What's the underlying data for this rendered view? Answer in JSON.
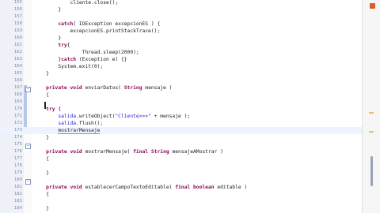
{
  "editor": {
    "lines": [
      {
        "num": "155",
        "code": "            cliente.close();"
      },
      {
        "num": "156",
        "code": "        }"
      },
      {
        "num": "157",
        "code": ""
      },
      {
        "num": "158",
        "code": "        catch( IOException excepcionES ) {"
      },
      {
        "num": "159",
        "code": "            excepcionES.printStackTrace();"
      },
      {
        "num": "160",
        "code": "        }"
      },
      {
        "num": "161",
        "code": "        try{"
      },
      {
        "num": "162",
        "code": "                Thread.sleep(2000);"
      },
      {
        "num": "163",
        "code": "        }catch (Exception e) {}"
      },
      {
        "num": "164",
        "code": "        System.exit(0);"
      },
      {
        "num": "165",
        "code": "    }"
      },
      {
        "num": "166",
        "code": ""
      },
      {
        "num": "167",
        "code": "    private void enviarDatos( String mensaje )"
      },
      {
        "num": "168",
        "code": "    {"
      },
      {
        "num": "169",
        "code": ""
      },
      {
        "num": "170",
        "code": "    try {"
      },
      {
        "num": "171",
        "code": "        salida.writeObject(\"Cliente>>>\" + mensaje );"
      },
      {
        "num": "172",
        "code": "        salida.flush();"
      },
      {
        "num": "173",
        "code": "        mostrarMensaje"
      },
      {
        "num": "174",
        "code": "    }"
      },
      {
        "num": "175",
        "code": ""
      },
      {
        "num": "176",
        "code": "    private void mostrarMensaje( final String mensajeAMostrar )"
      },
      {
        "num": "177",
        "code": "    {"
      },
      {
        "num": "178",
        "code": ""
      },
      {
        "num": "179",
        "code": "    }"
      },
      {
        "num": "180",
        "code": ""
      },
      {
        "num": "181",
        "code": "    private void establecerCampoTextoEditable( final boolean editable )"
      },
      {
        "num": "182",
        "code": "    {"
      },
      {
        "num": "183",
        "code": ""
      },
      {
        "num": "184",
        "code": "    }"
      }
    ]
  }
}
